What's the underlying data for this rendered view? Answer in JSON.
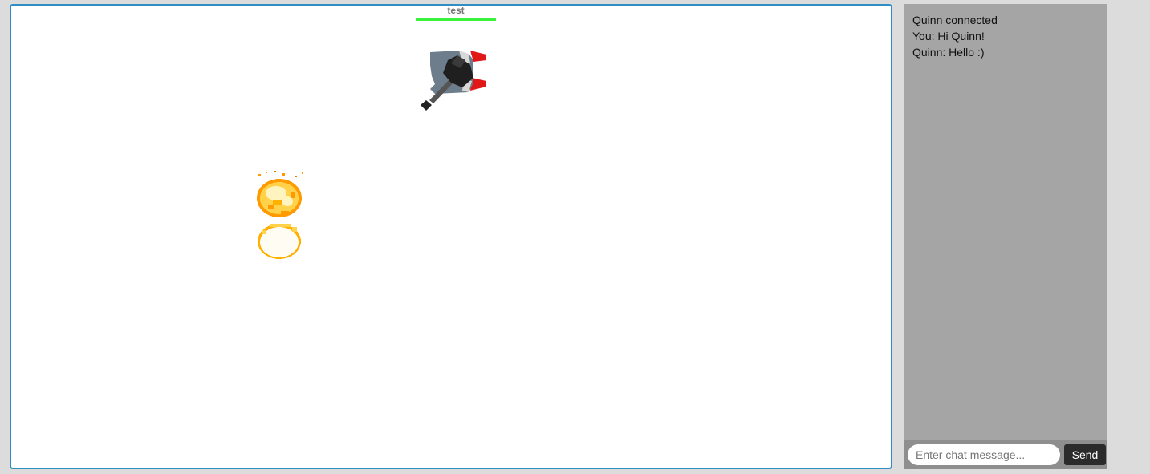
{
  "game": {
    "player": {
      "name": "test",
      "health_fraction": 1.0,
      "health_color": "#3cf03c"
    },
    "entities": [
      {
        "kind": "tank",
        "icon": "tank-icon",
        "turret_color": "#222222",
        "hull_color": "#6d7d8b",
        "tread_color": "#e01818"
      },
      {
        "kind": "explosion",
        "icon": "explosion-icon",
        "colors": [
          "#ff9a00",
          "#ffd24a",
          "#fff4c0"
        ]
      }
    ]
  },
  "chat": {
    "messages": [
      {
        "text": "Quinn connected"
      },
      {
        "text": "You: Hi Quinn!"
      },
      {
        "text": "Quinn: Hello :)"
      }
    ],
    "input": {
      "placeholder": "Enter chat message...",
      "value": ""
    },
    "send_label": "Send"
  }
}
